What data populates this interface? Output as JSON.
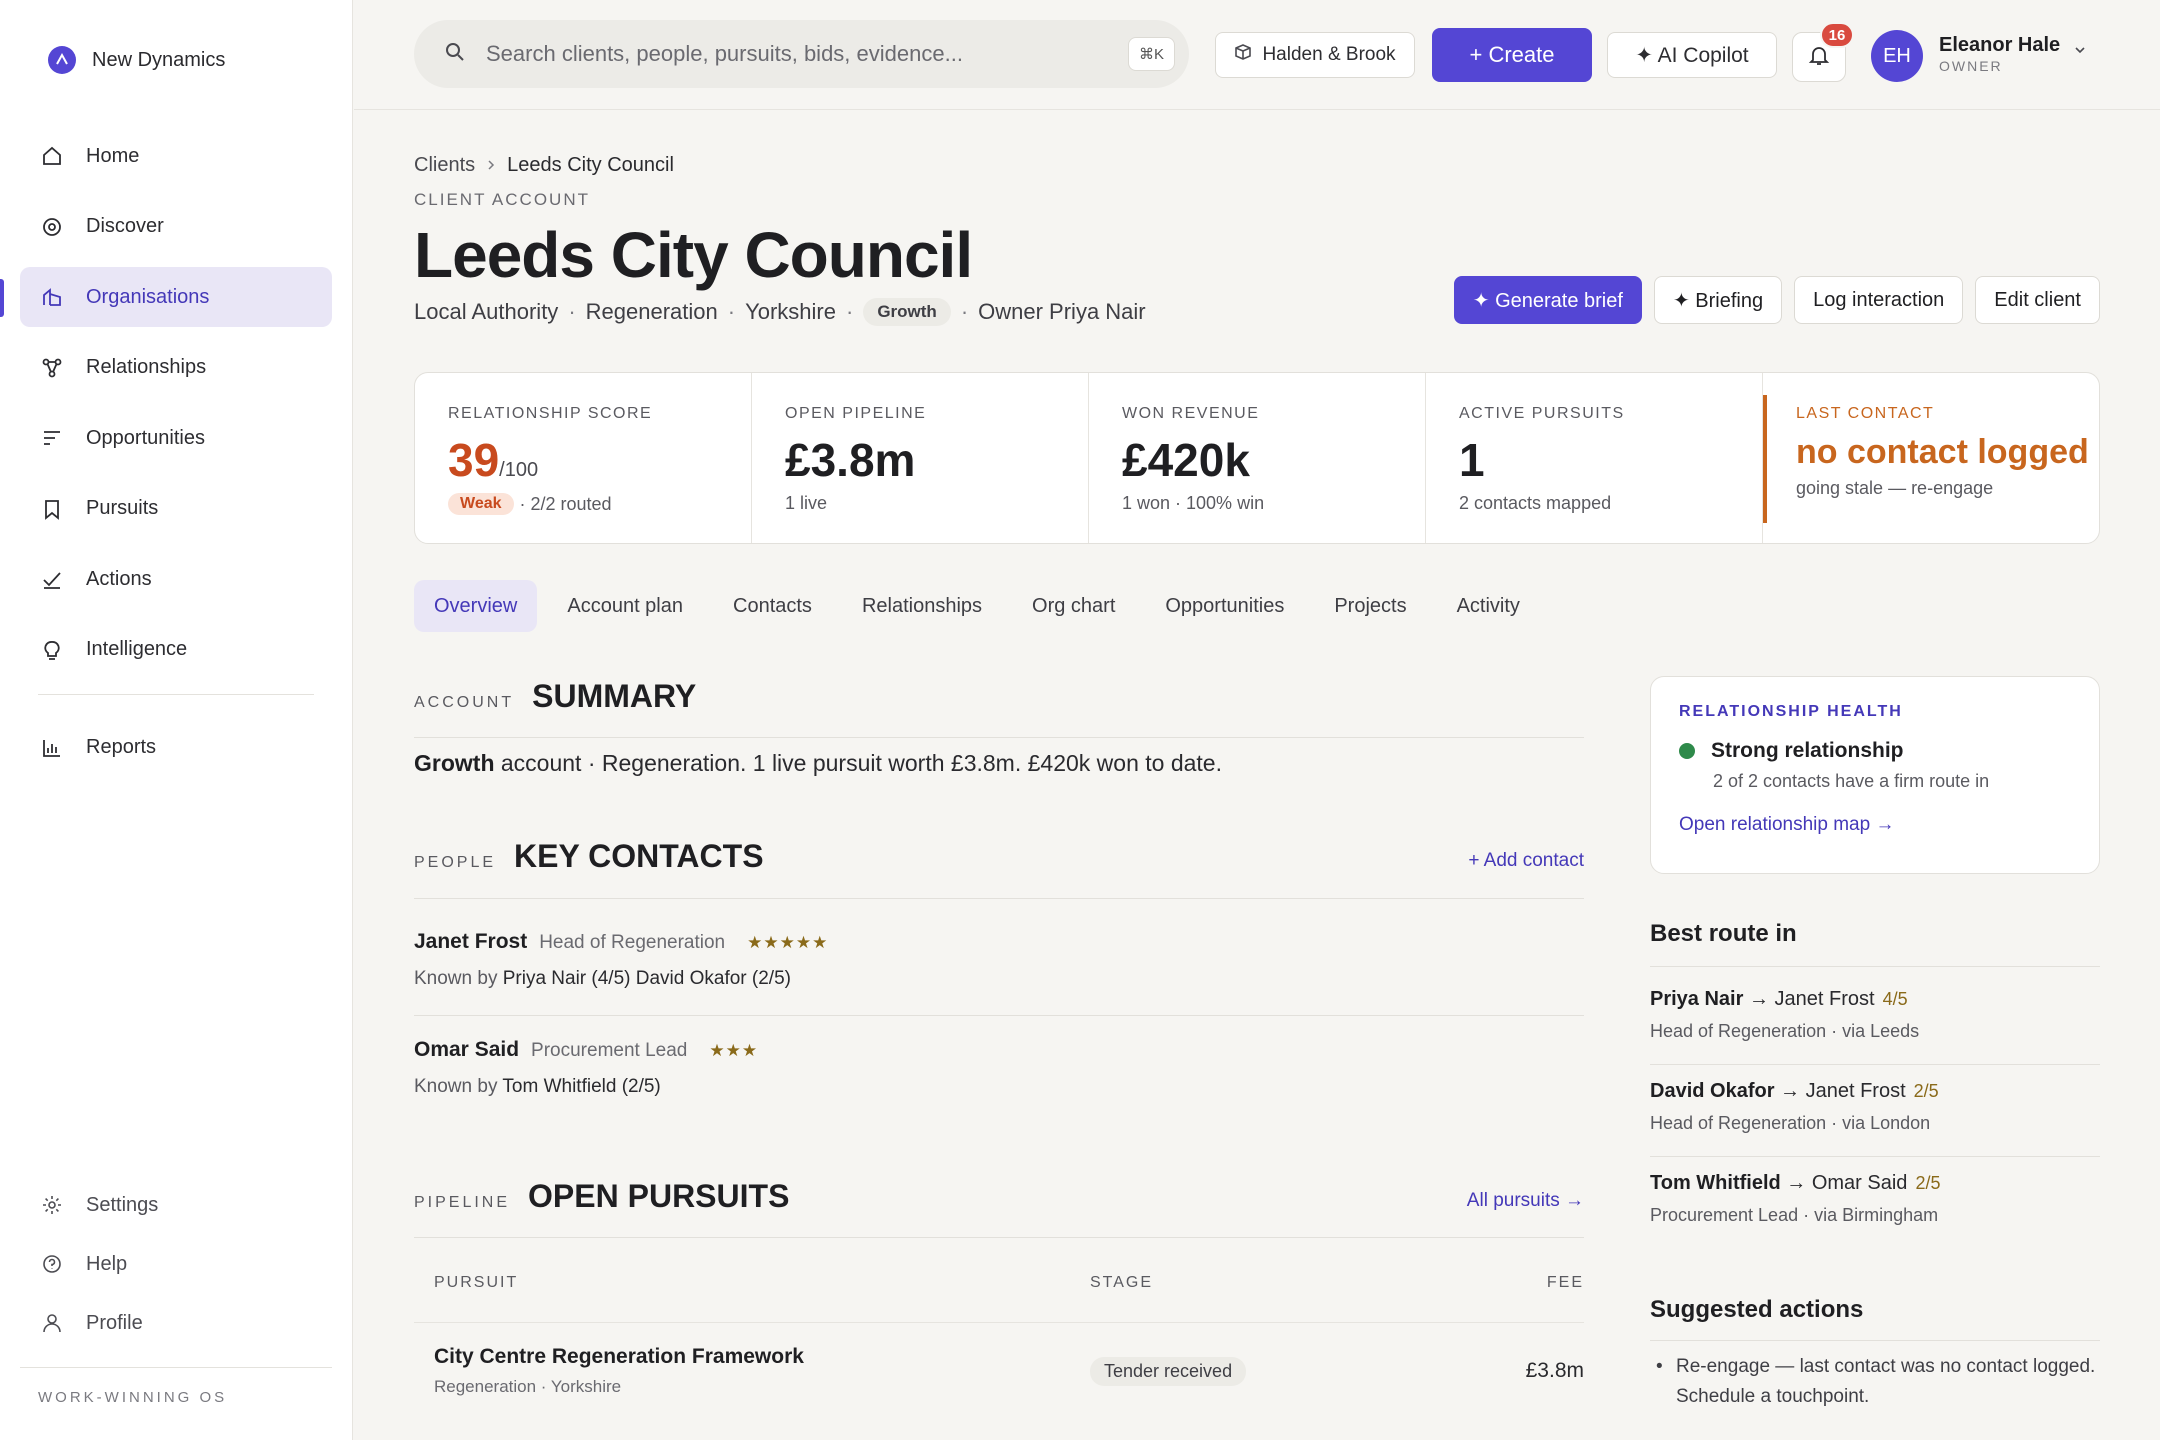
{
  "brand": {
    "name": "New Dynamics",
    "footer": "WORK-WINNING OS"
  },
  "nav": {
    "items": [
      {
        "label": "Home",
        "icon": "home-icon"
      },
      {
        "label": "Discover",
        "icon": "compass-icon"
      },
      {
        "label": "Organisations",
        "icon": "building-icon",
        "active": true
      },
      {
        "label": "Relationships",
        "icon": "network-icon"
      },
      {
        "label": "Opportunities",
        "icon": "list-icon"
      },
      {
        "label": "Pursuits",
        "icon": "bookmark-icon"
      },
      {
        "label": "Actions",
        "icon": "check-icon"
      },
      {
        "label": "Intelligence",
        "icon": "bulb-icon"
      }
    ],
    "reports": {
      "label": "Reports",
      "icon": "bar-chart-icon"
    },
    "bottom": [
      {
        "label": "Settings",
        "icon": "gear-icon"
      },
      {
        "label": "Help",
        "icon": "help-icon"
      },
      {
        "label": "Profile",
        "icon": "user-icon"
      }
    ]
  },
  "topbar": {
    "search_placeholder": "Search clients, people, pursuits, bids, evidence...",
    "shortcut": "⌘K",
    "workspace": "Halden & Brook",
    "create": "+ Create",
    "copilot": "✦ AI Copilot",
    "notifications": "16",
    "user": {
      "initials": "EH",
      "name": "Eleanor Hale",
      "role": "OWNER"
    }
  },
  "breadcrumb": {
    "root": "Clients",
    "current": "Leeds City Council"
  },
  "client": {
    "eyebrow": "CLIENT ACCOUNT",
    "name": "Leeds City Council",
    "type": "Local Authority",
    "sector": "Regeneration",
    "region": "Yorkshire",
    "tier": "Growth",
    "owner": "Owner Priya Nair"
  },
  "actions": {
    "generate": "✦ Generate brief",
    "briefing": "✦ Briefing",
    "log": "Log interaction",
    "edit": "Edit client"
  },
  "kpis": {
    "relationship": {
      "label": "RELATIONSHIP SCORE",
      "score": "39",
      "denom": "/100",
      "badge": "Weak",
      "sub": "· 2/2 routed"
    },
    "pipeline": {
      "label": "OPEN PIPELINE",
      "value": "£3.8m",
      "sub": "1 live"
    },
    "won": {
      "label": "WON REVENUE",
      "value": "£420k",
      "sub": "1 won · 100% win"
    },
    "pursuits": {
      "label": "ACTIVE PURSUITS",
      "value": "1",
      "sub": "2 contacts mapped"
    },
    "last_contact": {
      "label": "LAST CONTACT",
      "value": "no contact logged",
      "sub": "going stale — re-engage"
    }
  },
  "tabs": [
    "Overview",
    "Account plan",
    "Contacts",
    "Relationships",
    "Org chart",
    "Opportunities",
    "Projects",
    "Activity"
  ],
  "summary": {
    "eyebrow": "ACCOUNT",
    "title": "SUMMARY",
    "lead": "Growth",
    "text": " account · Regeneration. 1 live pursuit worth £3.8m. £420k won to date."
  },
  "contacts": {
    "eyebrow": "PEOPLE",
    "title": "KEY CONTACTS",
    "add": "+ Add contact",
    "items": [
      {
        "name": "Janet Frost",
        "role": "Head of Regeneration",
        "stars": "★★★★★",
        "known_label": "Known by",
        "known": "Priya Nair (4/5)  David Okafor (2/5)"
      },
      {
        "name": "Omar Said",
        "role": "Procurement Lead",
        "stars": "★★★",
        "known_label": "Known by",
        "known": "Tom Whitfield (2/5)"
      }
    ]
  },
  "pursuits": {
    "eyebrow": "PIPELINE",
    "title": "OPEN PURSUITS",
    "link": "All pursuits →",
    "columns": [
      "PURSUIT",
      "STAGE",
      "FEE"
    ],
    "rows": [
      {
        "name": "City Centre Regeneration Framework",
        "sub": "Regeneration · Yorkshire",
        "stage": "Tender received",
        "fee": "£3.8m"
      }
    ]
  },
  "health": {
    "label": "RELATIONSHIP HEALTH",
    "status": "Strong relationship",
    "status_color": "#2e8a4a",
    "sub": "2 of 2 contacts have a firm route in",
    "link": "Open relationship map →"
  },
  "routes": {
    "title": "Best route in",
    "items": [
      {
        "from": "Priya Nair",
        "to": "→ Janet Frost",
        "score": "4/5",
        "sub": "Head of Regeneration · via Leeds"
      },
      {
        "from": "David Okafor",
        "to": "→ Janet Frost",
        "score": "2/5",
        "sub": "Head of Regeneration · via London"
      },
      {
        "from": "Tom Whitfield",
        "to": "→ Omar Said",
        "score": "2/5",
        "sub": "Procurement Lead · via Birmingham"
      }
    ]
  },
  "suggested": {
    "title": "Suggested actions",
    "items": [
      "Re-engage — last contact was no contact logged. Schedule a touchpoint."
    ]
  },
  "colors": {
    "accent": "#5446d4",
    "warning": "#c8661e",
    "score": "#c84a1e"
  }
}
